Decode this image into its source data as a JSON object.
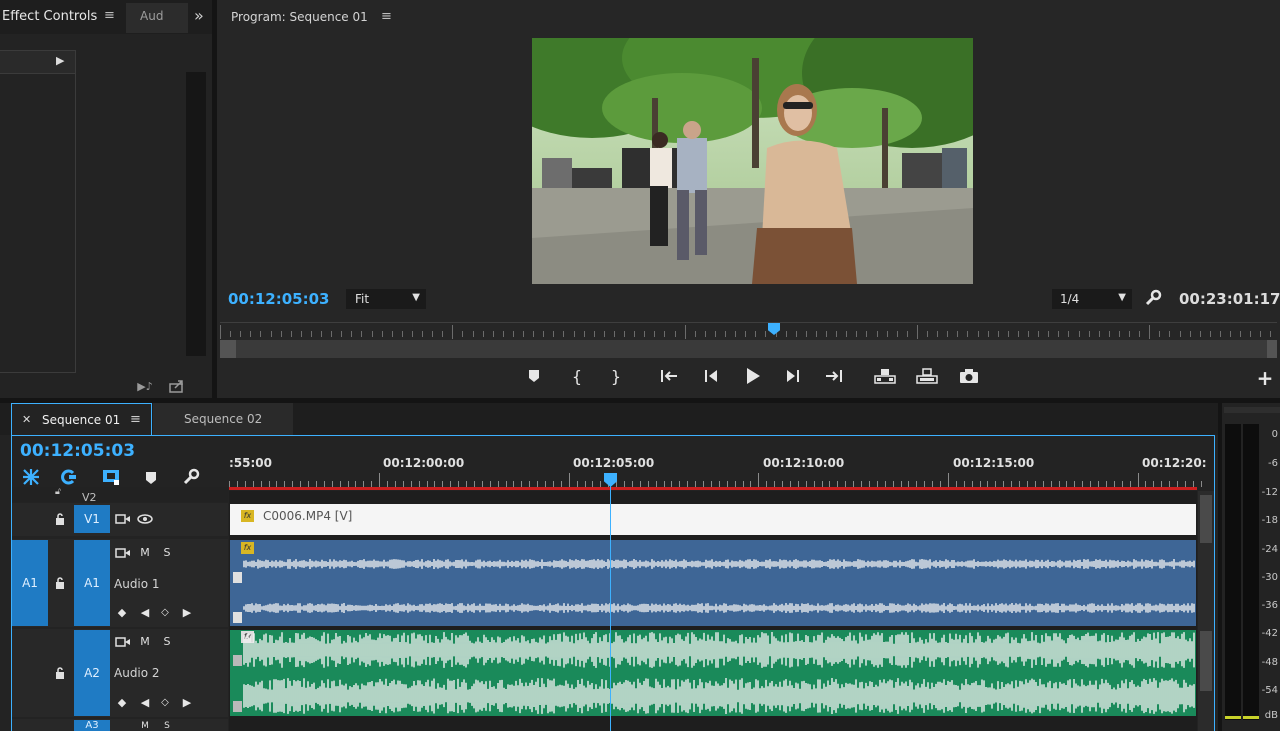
{
  "effect_controls": {
    "tab_label": "Effect Controls",
    "second_tab": "Aud",
    "overflow": "»"
  },
  "program_monitor": {
    "title": "Program: Sequence 01",
    "current_timecode": "00:12:05:03",
    "zoom_value": "Fit",
    "resolution_value": "1/4",
    "duration_timecode": "00:23:01:17",
    "playhead_fraction": 0.5
  },
  "timeline": {
    "tabs": [
      {
        "label": "Sequence 01",
        "active": true
      },
      {
        "label": "Sequence 02",
        "active": false
      }
    ],
    "current_timecode": "00:12:05:03",
    "ruler_labels": [
      ":55:00",
      "00:12:00:00",
      "00:12:05:00",
      "00:12:10:00",
      "00:12:15:00",
      "00:12:20:"
    ],
    "tracks": {
      "v2": {
        "label": "V2"
      },
      "v1": {
        "label": "V1",
        "clip_name": "C0006.MP4 [V]"
      },
      "a1": {
        "source_label": "A1",
        "label": "A1",
        "name": "Audio 1",
        "m": "M",
        "s": "S"
      },
      "a2": {
        "label": "A2",
        "name": "Audio 2",
        "m": "M",
        "s": "S"
      },
      "a3": {
        "label": "A3",
        "m": "M",
        "s": "S"
      }
    }
  },
  "audio_meter": {
    "scale": [
      "0",
      "-6",
      "-12",
      "-18",
      "-24",
      "-30",
      "-36",
      "-42",
      "-48",
      "-54",
      "dB"
    ]
  },
  "colors": {
    "accent": "#3db1ff",
    "track_blue": "#1f7bc4",
    "audio1_clip": "#3e6696",
    "audio2_clip": "#1a8a5a",
    "playhead": "#3db1ff",
    "work_area_bar": "#cc1f1f"
  }
}
